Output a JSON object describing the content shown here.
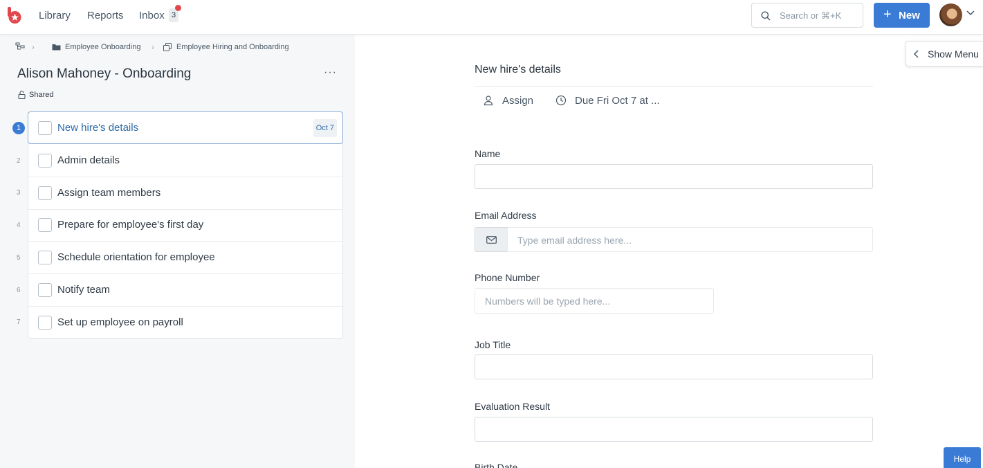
{
  "nav": {
    "library": "Library",
    "reports": "Reports",
    "inbox": "Inbox",
    "inbox_count": "3",
    "search_placeholder": "Search or ⌘+K",
    "new_label": "New"
  },
  "breadcrumb": {
    "folder": "Employee Onboarding",
    "workflow": "Employee Hiring and Onboarding"
  },
  "run": {
    "title": "Alison Mahoney - Onboarding",
    "more": "···",
    "shared": "Shared"
  },
  "tasks": [
    {
      "num": "1",
      "name": "New hire's details",
      "due": "Oct 7"
    },
    {
      "num": "2",
      "name": "Admin details"
    },
    {
      "num": "3",
      "name": "Assign team members"
    },
    {
      "num": "4",
      "name": "Prepare for employee's first day"
    },
    {
      "num": "5",
      "name": "Schedule orientation for employee"
    },
    {
      "num": "6",
      "name": "Notify team"
    },
    {
      "num": "7",
      "name": "Set up employee on payroll"
    }
  ],
  "form": {
    "title": "New hire's details",
    "assign": "Assign",
    "due": "Due Fri Oct 7 at ...",
    "name_label": "Name",
    "email_label": "Email Address",
    "email_placeholder": "Type email address here...",
    "phone_label": "Phone Number",
    "phone_placeholder": "Numbers will be typed here...",
    "job_label": "Job Title",
    "eval_label": "Evaluation Result",
    "birth_label": "Birth Date"
  },
  "show_menu": "Show Menu",
  "help": "Help",
  "colors": {
    "accent": "#3a7bd5",
    "badge_dot": "#e0474c",
    "logo": "#e2474b"
  }
}
